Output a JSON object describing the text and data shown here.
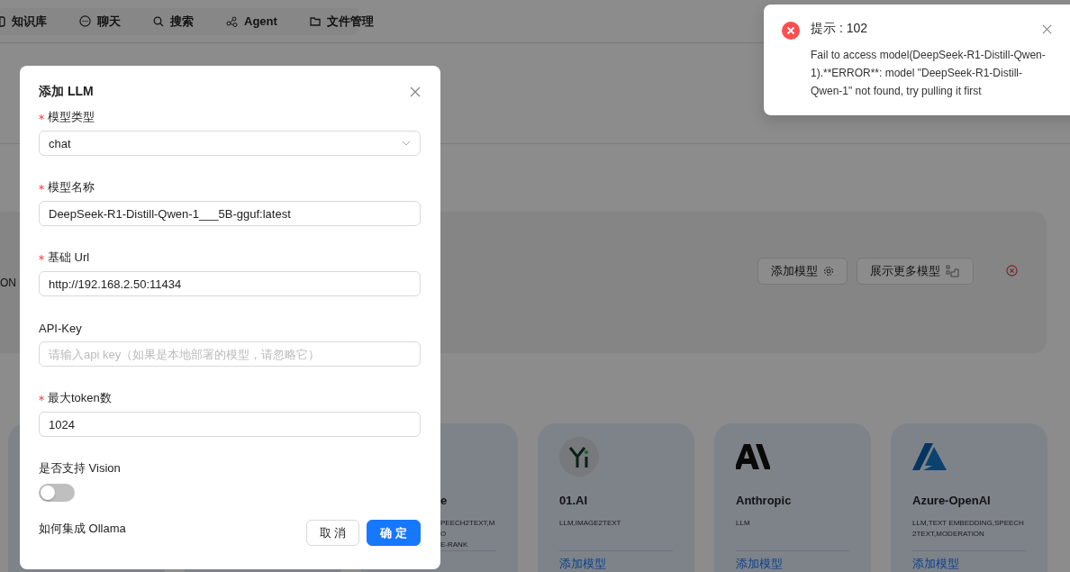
{
  "nav": [
    {
      "label": "知识库"
    },
    {
      "label": "聊天"
    },
    {
      "label": "搜索"
    },
    {
      "label": "Agent"
    },
    {
      "label": "文件管理"
    }
  ],
  "panel": {
    "cut_text": "ON",
    "buttons": [
      {
        "label": "添加模型"
      },
      {
        "label": "展示更多模型"
      }
    ]
  },
  "cards": [
    {
      "kind": "blank"
    },
    {
      "kind": "blank"
    },
    {
      "kind": "partial",
      "title": "e",
      "tags": "PEECH2TEXT,MO\nE-RANK"
    },
    {
      "kind": "yi",
      "title": "01.AI",
      "tags": "LLM,IMAGE2TEXT",
      "link": "添加模型"
    },
    {
      "kind": "anthropic",
      "title": "Anthropic",
      "tags": "LLM",
      "link": "添加模型"
    },
    {
      "kind": "azure",
      "title": "Azure-OpenAI",
      "tags": "LLM,TEXT EMBEDDING,SPEECH2TEXT,MODERATION",
      "link": "添加模型"
    }
  ],
  "modal": {
    "title": "添加 LLM",
    "fields": [
      {
        "kind": "select",
        "label": "模型类型",
        "required": true,
        "value": "chat"
      },
      {
        "kind": "input",
        "label": "模型名称",
        "required": true,
        "value": "DeepSeek-R1-Distill-Qwen-1___5B-gguf:latest"
      },
      {
        "kind": "input",
        "label": "基础 Url",
        "required": true,
        "value": "http://192.168.2.50:11434"
      },
      {
        "kind": "input",
        "label": "API-Key",
        "required": false,
        "placeholder": "请输入api key（如果是本地部署的模型，请忽略它）"
      },
      {
        "kind": "input",
        "label": "最大token数",
        "required": true,
        "value": "1024"
      },
      {
        "kind": "switch",
        "label": "是否支持 Vision",
        "required": false,
        "on": false
      }
    ],
    "help_link": "如何集成 Ollama",
    "cancel": "取 消",
    "ok": "确 定"
  },
  "toast": {
    "title": "提示 : 102",
    "message": "Fail to access model(DeepSeek-R1-Distill-Qwen-1).**ERROR**: model \"DeepSeek-R1-Distill-Qwen-1\" not found, try pulling it first"
  }
}
